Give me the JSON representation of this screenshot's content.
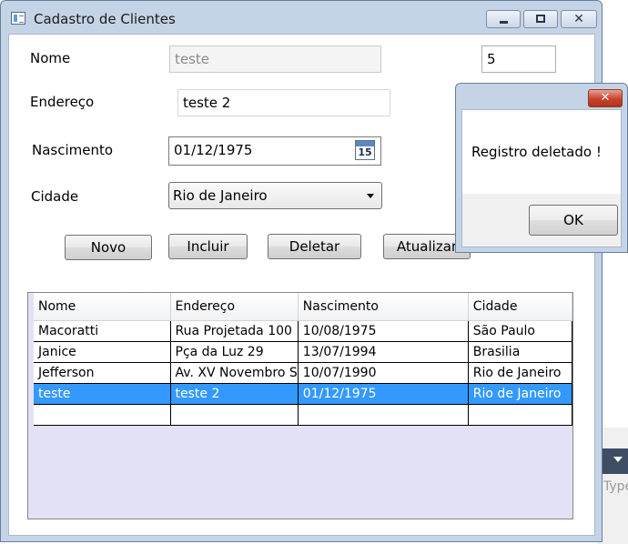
{
  "window": {
    "title": "Cadastro de Clientes",
    "minimize_icon": "minimize-icon",
    "maximize_icon": "maximize-icon",
    "close_glyph": "✕"
  },
  "form": {
    "nome_label": "Nome",
    "nome_value": "teste",
    "id_value": "5",
    "endereco_label": "Endereço",
    "endereco_value": "teste 2",
    "nascimento_label": "Nascimento",
    "nascimento_value": "01/12/1975",
    "calendar_day": "15",
    "cidade_label": "Cidade",
    "cidade_value": "Rio de Janeiro"
  },
  "buttons": {
    "novo": "Novo",
    "incluir": "Incluir",
    "deletar": "Deletar",
    "atualizar": "Atualizar"
  },
  "grid": {
    "columns": [
      "Nome",
      "Endereço",
      "Nascimento",
      "Cidade"
    ],
    "rows": [
      [
        "Macoratti",
        "Rua Projetada 100",
        "10/08/1975",
        "São Paulo"
      ],
      [
        "Janice",
        "Pça da Luz 29",
        "13/07/1994",
        "Brasilia"
      ],
      [
        "Jefferson",
        "Av.  XV Novembro S",
        "10/07/1990",
        "Rio de Janeiro"
      ],
      [
        "teste",
        "teste 2",
        "01/12/1975",
        "Rio de Janeiro"
      ],
      [
        "",
        "",
        "",
        ""
      ]
    ],
    "selected_row_index": 3,
    "selection_color": "#3399ff"
  },
  "dialog": {
    "message": "Registro deletado !",
    "ok_label": "OK",
    "close_glyph": "✕"
  },
  "background": {
    "partial_text": "Type"
  }
}
